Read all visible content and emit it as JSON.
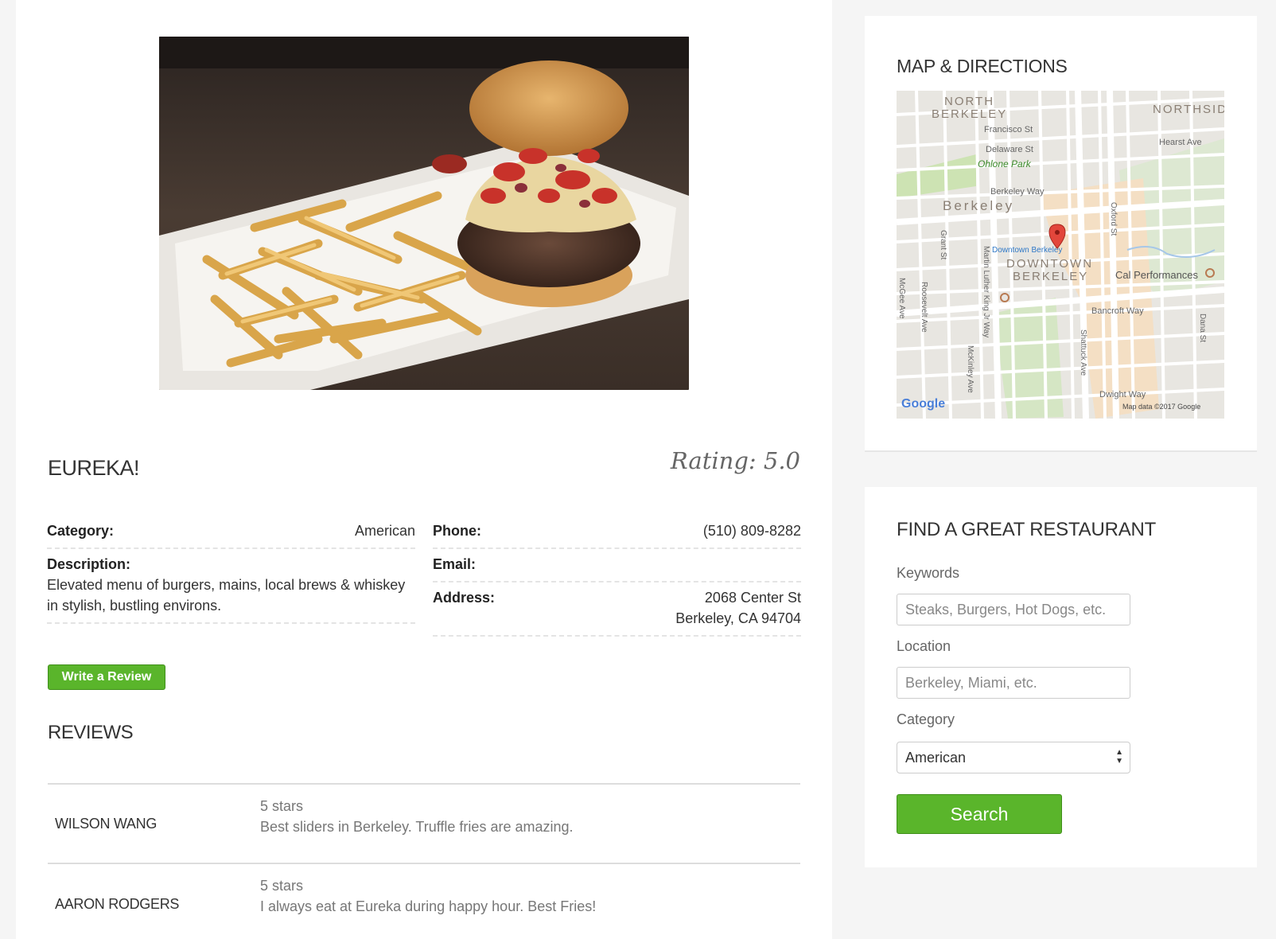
{
  "restaurant": {
    "name": "EUREKA!",
    "rating": "Rating: 5.0",
    "category_label": "Category:",
    "category": "American",
    "description_label": "Description:",
    "description": "Elevated menu of burgers, mains, local brews & whiskey in stylish, bustling environs.",
    "phone_label": "Phone:",
    "phone": "(510) 809-8282",
    "email_label": "Email:",
    "email": "",
    "address_label": "Address:",
    "address_line1": "2068 Center St",
    "address_line2": "Berkeley, CA 94704"
  },
  "write_review_label": "Write a Review",
  "reviews_title": "REVIEWS",
  "reviews": [
    {
      "name": "WILSON WANG",
      "stars": "5 stars",
      "text": "Best sliders in Berkeley. Truffle fries are amazing."
    },
    {
      "name": "AARON RODGERS",
      "stars": "5 stars",
      "text": "I always eat at Eureka during happy hour. Best Fries!"
    }
  ],
  "map": {
    "title": "MAP & DIRECTIONS",
    "labels": {
      "north_berkeley": "NORTH",
      "north_berkeley_2": "BERKELEY",
      "northside": "NORTHSID",
      "francisco": "Francisco St",
      "delaware": "Delaware St",
      "ohlone": "Ohlone Park",
      "hearst": "Hearst Ave",
      "berkeley_way": "Berkeley Way",
      "berkeley": "Berkeley",
      "oxford": "Oxford St",
      "grant": "Grant St",
      "downtown_station": "Downtown Berkeley",
      "downtown": "DOWNTOWN",
      "downtown_2": "BERKELEY",
      "cal_perf": "Cal Performances",
      "mlk": "Martin Luther King Jr Way",
      "mcgee": "McGee Ave",
      "roosevelt": "Roosevelt Ave",
      "bancroft": "Bancroft Way",
      "mckinley": "McKinley Ave",
      "shattuck": "Shattuck Ave",
      "dana": "Dana St",
      "dwight": "Dwight Way",
      "google": "Google",
      "map_data": "Map data ©2017 Google"
    }
  },
  "search": {
    "title": "FIND A GREAT RESTAURANT",
    "keywords_label": "Keywords",
    "keywords_placeholder": "Steaks, Burgers, Hot Dogs, etc.",
    "location_label": "Location",
    "location_placeholder": "Berkeley, Miami, etc.",
    "category_label": "Category",
    "category_value": "American",
    "button_label": "Search"
  }
}
